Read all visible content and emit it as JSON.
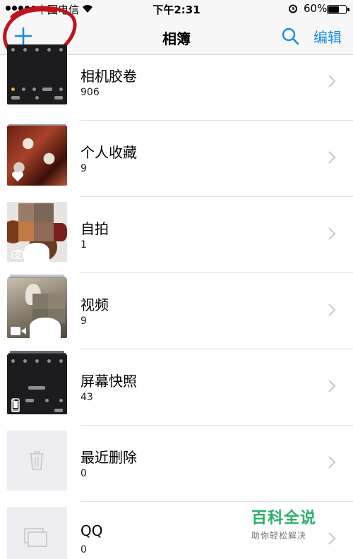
{
  "status_bar": {
    "carrier": "中国电信",
    "time": "下午2:31",
    "battery_percent": "60%",
    "battery_level": 0.6
  },
  "nav": {
    "title": "相簿",
    "edit_label": "编辑",
    "icons": {
      "add": "plus-icon",
      "search": "search-icon"
    },
    "accent_color": "#1a8ae6",
    "annotation_color": "#c0141c"
  },
  "albums": [
    {
      "name": "相机胶卷",
      "count": "906",
      "thumb": "dark-screenshot"
    },
    {
      "name": "个人收藏",
      "count": "9",
      "thumb": "photo-heart-icon"
    },
    {
      "name": "自拍",
      "count": "1",
      "thumb": "selfie-camera-icon"
    },
    {
      "name": "视频",
      "count": "9",
      "thumb": "video-camera-icon"
    },
    {
      "name": "屏幕快照",
      "count": "43",
      "thumb": "dark-screenshot-phone-icon"
    },
    {
      "name": "最近删除",
      "count": "0",
      "thumb": "trash-icon"
    },
    {
      "name": "QQ",
      "count": "0",
      "thumb": "photos-stack-icon"
    }
  ],
  "watermark": {
    "title": "百科全说",
    "subtitle": "助你轻松解决"
  }
}
